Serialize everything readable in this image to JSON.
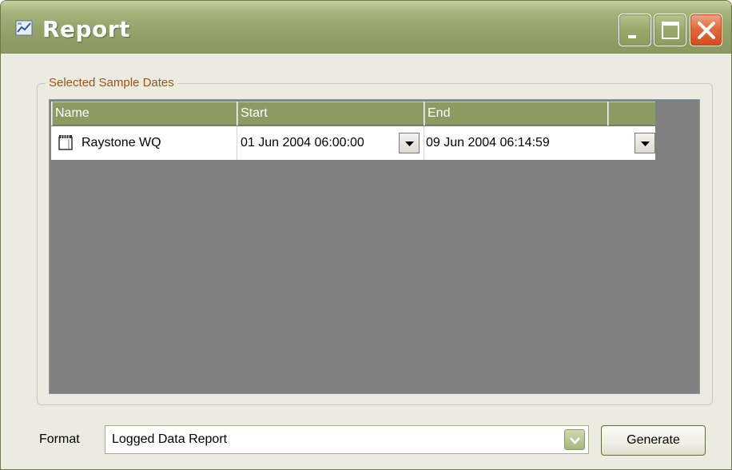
{
  "window": {
    "title": "Report",
    "title_color": "#ffffff",
    "titlebar_color": "#94a46b"
  },
  "titlebar_buttons": {
    "minimize_icon": "minimize-icon",
    "maximize_icon": "maximize-icon",
    "close_icon": "close-icon"
  },
  "group": {
    "label": "Selected Sample Dates",
    "label_color": "#a0520f"
  },
  "grid": {
    "columns": [
      "Name",
      "Start",
      "End"
    ],
    "header_color": "#8a9c62",
    "background_color": "#808080",
    "rows": [
      {
        "icon": "document-icon",
        "name": "Raystone WQ",
        "start": "01 Jun 2004 06:00:00",
        "end": "09 Jun 2004 06:14:59"
      }
    ]
  },
  "format": {
    "label": "Format",
    "selected": "Logged Data Report"
  },
  "generate_button": {
    "label": "Generate"
  }
}
